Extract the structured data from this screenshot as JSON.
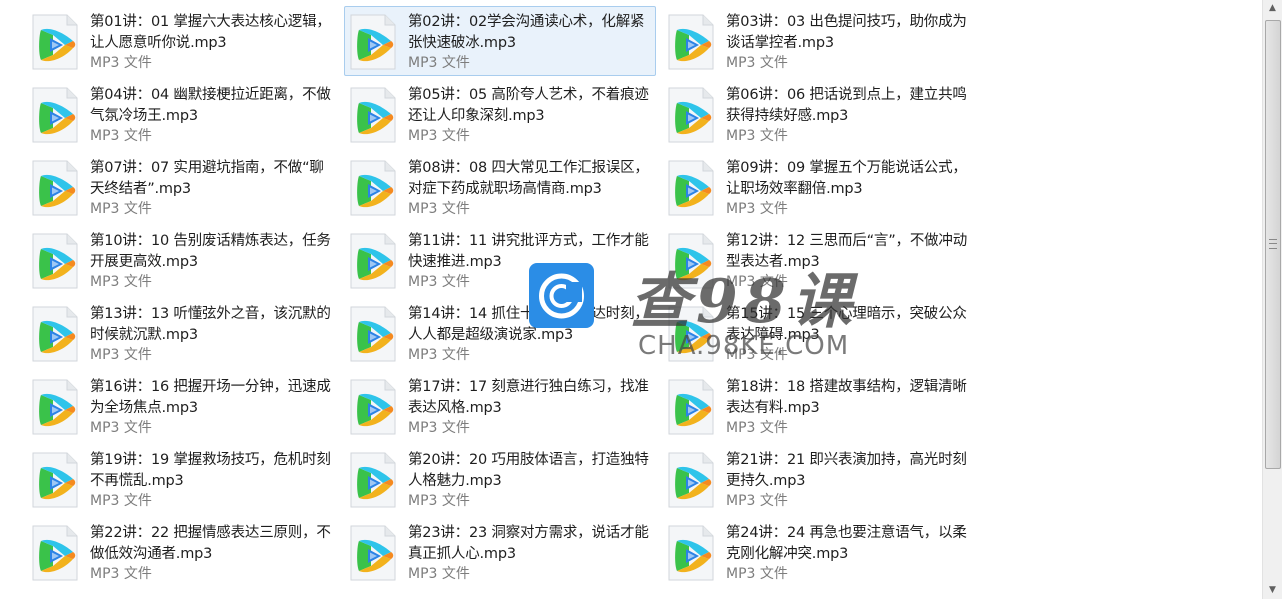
{
  "file_type_label": "MP3 文件",
  "selected_index": 1,
  "icon": {
    "name": "video-player-icon",
    "colors": {
      "page": "#f4f6f8",
      "top": "#2ec4ea",
      "left": "#3ac24a",
      "bottom": "#f2b21d",
      "right": "#f58a1f",
      "core": "#2c83e6"
    }
  },
  "files": [
    {
      "name": "第01讲：01 掌握六大表达核心逻辑，让人愿意听你说.mp3"
    },
    {
      "name": "第02讲：02学会沟通读心术，化解紧张快速破冰.mp3"
    },
    {
      "name": "第03讲：03 出色提问技巧，助你成为谈话掌控者.mp3"
    },
    {
      "name": "第04讲：04 幽默接梗拉近距离，不做气氛冷场王.mp3"
    },
    {
      "name": "第05讲：05 高阶夸人艺术，不着痕迹还让人印象深刻.mp3"
    },
    {
      "name": "第06讲：06 把话说到点上，建立共鸣获得持续好感.mp3"
    },
    {
      "name": "第07讲：07 实用避坑指南，不做“聊天终结者”.mp3"
    },
    {
      "name": "第08讲：08 四大常见工作汇报误区，对症下药成就职场高情商.mp3"
    },
    {
      "name": "第09讲：09 掌握五个万能说话公式，让职场效率翻倍.mp3"
    },
    {
      "name": "第10讲：10 告别废话精炼表达，任务开展更高效.mp3"
    },
    {
      "name": "第11讲：11 讲究批评方式，工作才能快速推进.mp3"
    },
    {
      "name": "第12讲：12 三思而后“言”，不做冲动型表达者.mp3"
    },
    {
      "name": "第13讲：13 听懂弦外之音，该沉默的时候就沉默.mp3"
    },
    {
      "name": "第14讲：14 抓住十大公众表达时刻，人人都是超级演说家.mp3"
    },
    {
      "name": "第15讲：15 三个心理暗示，突破公众表达障碍.mp3"
    },
    {
      "name": "第16讲：16 把握开场一分钟，迅速成为全场焦点.mp3"
    },
    {
      "name": "第17讲：17 刻意进行独白练习，找准表达风格.mp3"
    },
    {
      "name": "第18讲：18 搭建故事结构，逻辑清晰表达有料.mp3"
    },
    {
      "name": "第19讲：19 掌握救场技巧，危机时刻不再慌乱.mp3"
    },
    {
      "name": "第20讲：20 巧用肢体语言，打造独特人格魅力.mp3"
    },
    {
      "name": "第21讲：21 即兴表演加持，高光时刻更持久.mp3"
    },
    {
      "name": "第22讲：22 把握情感表达三原则，不做低效沟通者.mp3"
    },
    {
      "name": "第23讲：23 洞察对方需求，说话才能真正抓人心.mp3"
    },
    {
      "name": "第24讲：24 再急也要注意语气，以柔克刚化解冲突.mp3"
    }
  ],
  "watermark": {
    "chinese": "查98课",
    "latin": "CHA.98KE.COM",
    "color": "#2b8de6"
  },
  "scrollbar": {
    "up_arrow": "▲",
    "down_arrow": "▼",
    "thumb_fraction": 0.8
  }
}
